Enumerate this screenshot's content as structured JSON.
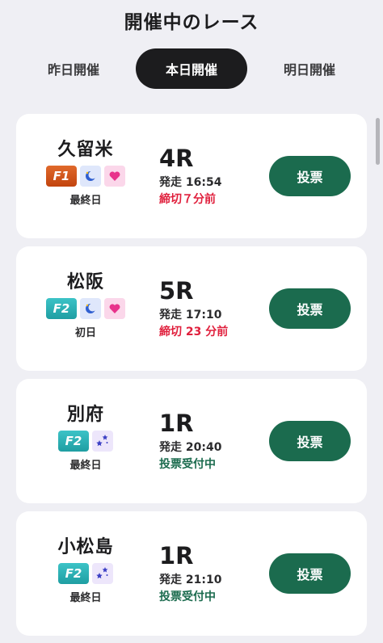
{
  "header": {
    "title": "開催中のレース"
  },
  "tabs": [
    {
      "label": "昨日開催",
      "active": false
    },
    {
      "label": "本日開催",
      "active": true
    },
    {
      "label": "明日開催",
      "active": false
    }
  ],
  "colors": {
    "accent": "#1b6b4e",
    "warning": "#e0203d",
    "f1": "#d2541a",
    "f2": "#2bb2b6",
    "day_badge": "#dfe7fb",
    "heart_badge": "#fbd7ea",
    "night_badge": "#ede6fb"
  },
  "races": [
    {
      "venue": "久留米",
      "grade": "F1",
      "icons": [
        "moon-sun-icon",
        "heart-icon"
      ],
      "day": "最終日",
      "race_no": "4R",
      "start": "発走 16:54",
      "status": "締切７分前",
      "status_type": "warning",
      "button": "投票"
    },
    {
      "venue": "松阪",
      "grade": "F2",
      "icons": [
        "moon-sun-icon",
        "heart-icon"
      ],
      "day": "初日",
      "race_no": "5R",
      "start": "発走 17:10",
      "status": "締切 23 分前",
      "status_type": "warning",
      "button": "投票"
    },
    {
      "venue": "別府",
      "grade": "F2",
      "icons": [
        "night-stars-icon"
      ],
      "day": "最終日",
      "race_no": "1R",
      "start": "発走 20:40",
      "status": "投票受付中",
      "status_type": "open",
      "button": "投票"
    },
    {
      "venue": "小松島",
      "grade": "F2",
      "icons": [
        "night-stars-icon"
      ],
      "day": "最終日",
      "race_no": "1R",
      "start": "発走 21:10",
      "status": "投票受付中",
      "status_type": "open",
      "button": "投票"
    }
  ]
}
